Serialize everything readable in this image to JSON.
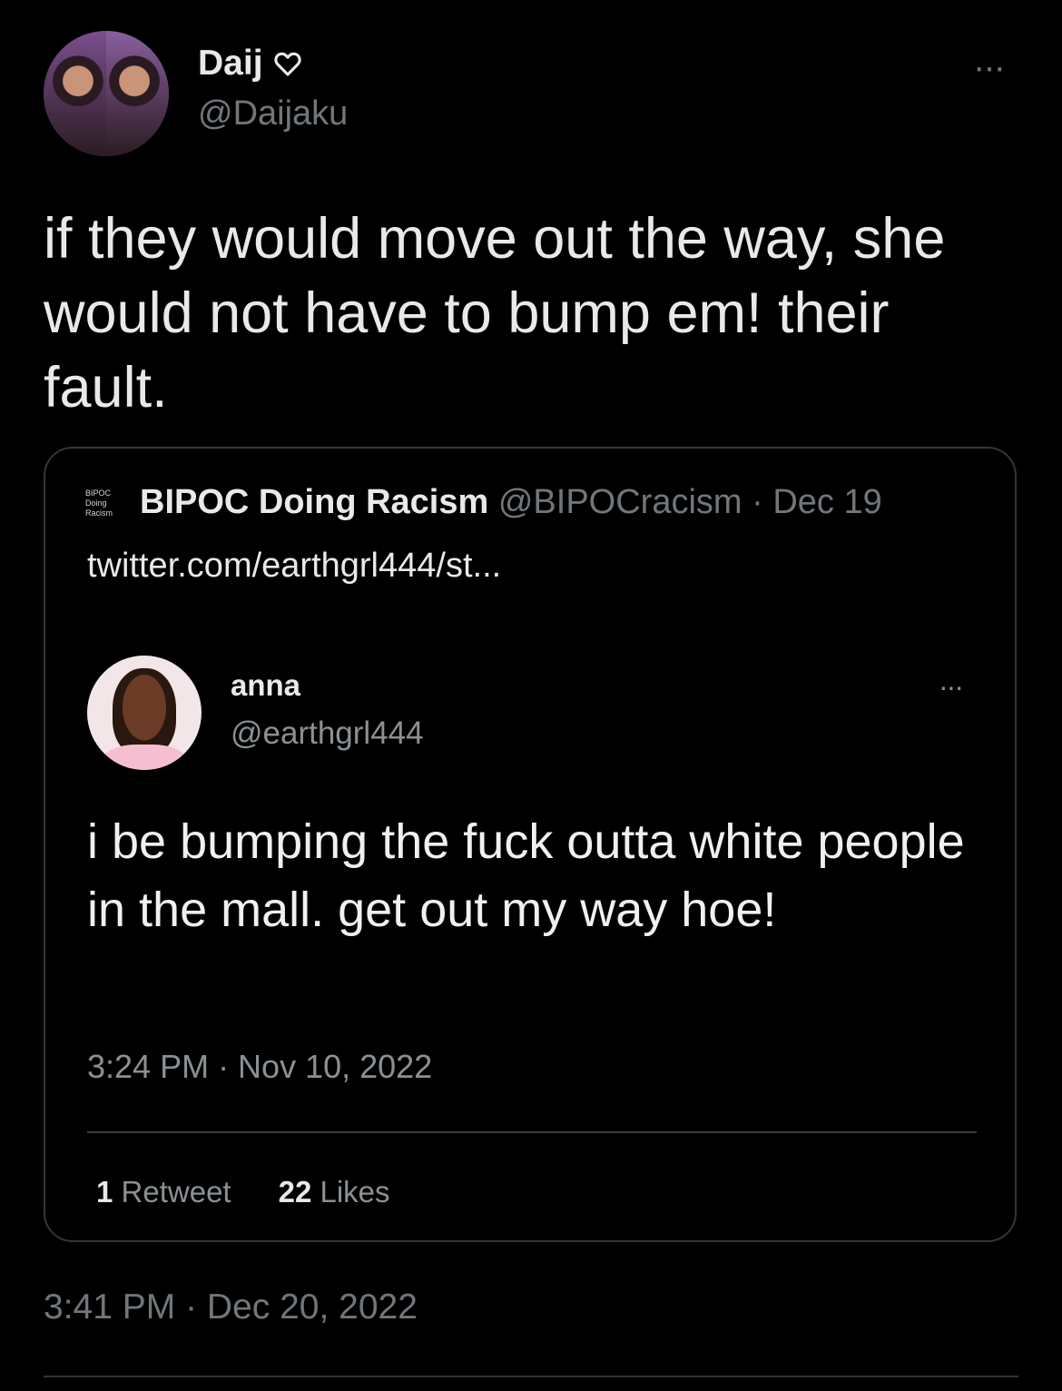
{
  "tweet": {
    "display_name": "Daij",
    "handle": "@Daijaku",
    "more_label": "···",
    "text": "if they would move out the way, she would not have to bump em! their fault.",
    "timestamp": "3:41 PM · Dec 20, 2022"
  },
  "quote": {
    "logo_text": "BIPOC Doing Racism",
    "name": "BIPOC Doing Racism",
    "meta": "@BIPOCracism · Dec 19",
    "link": "twitter.com/earthgrl444/st...",
    "embedded": {
      "name": "anna",
      "handle": "@earthgrl444",
      "more_label": "···",
      "text": "i be bumping the fuck outta white people in the mall. get out my way hoe!",
      "timestamp": "3:24 PM · Nov 10, 2022",
      "retweets_count": "1",
      "retweets_label": "Retweet",
      "likes_count": "22",
      "likes_label": "Likes"
    }
  },
  "colors": {
    "background": "#000000",
    "text": "#e7e9ea",
    "secondary": "#71767b",
    "border": "#333639"
  },
  "icons": {
    "heart": "heart-outline-icon",
    "more": "more-horizontal-icon"
  }
}
